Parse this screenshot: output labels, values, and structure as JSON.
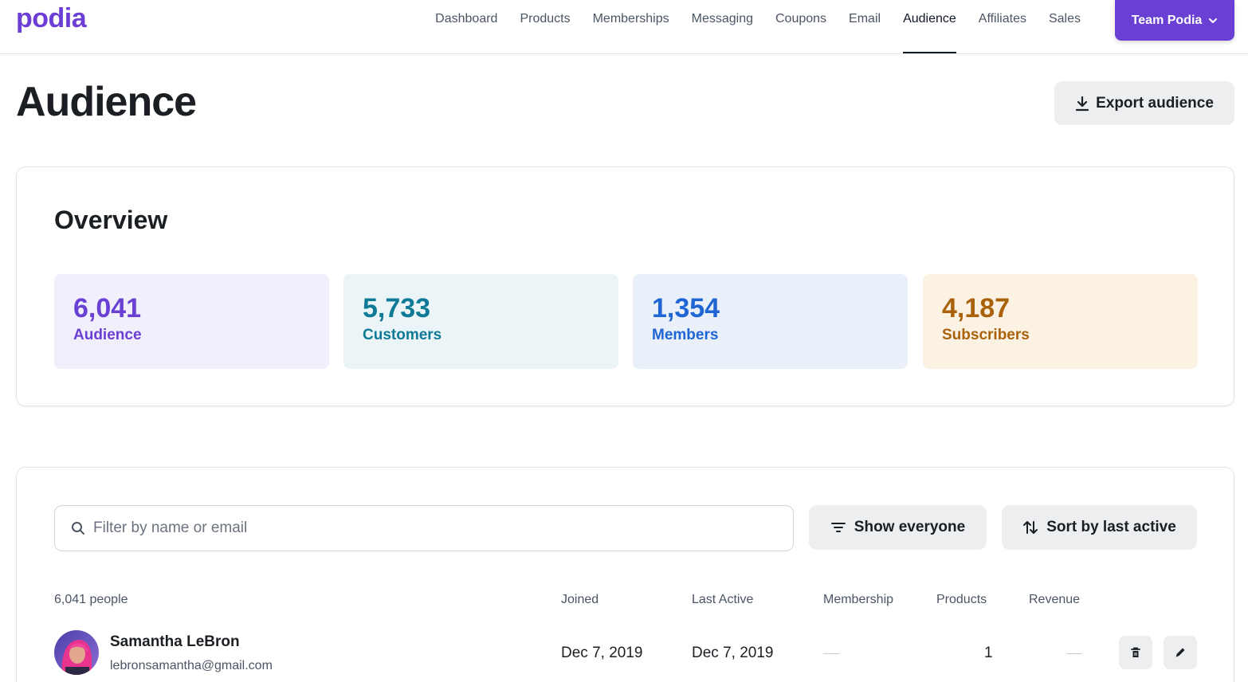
{
  "app": {
    "logo": "podia"
  },
  "nav": {
    "items": [
      {
        "label": "Dashboard"
      },
      {
        "label": "Products"
      },
      {
        "label": "Memberships"
      },
      {
        "label": "Messaging"
      },
      {
        "label": "Coupons"
      },
      {
        "label": "Email"
      },
      {
        "label": "Audience",
        "active": true
      },
      {
        "label": "Affiliates"
      },
      {
        "label": "Sales"
      }
    ],
    "team_button": "Team Podia"
  },
  "page": {
    "title": "Audience",
    "export_label": "Export audience"
  },
  "overview": {
    "title": "Overview",
    "stats": [
      {
        "value": "6,041",
        "label": "Audience",
        "bg": "#f1effb",
        "color": "#6a3fd3"
      },
      {
        "value": "5,733",
        "label": "Customers",
        "bg": "#ebf4f7",
        "color": "#0e7a96"
      },
      {
        "value": "1,354",
        "label": "Members",
        "bg": "#e9f0f9",
        "color": "#1f66d4"
      },
      {
        "value": "4,187",
        "label": "Subscribers",
        "bg": "#fbf2e3",
        "color": "#a9620b"
      }
    ]
  },
  "people": {
    "search_placeholder": "Filter by name or email",
    "show_label": "Show everyone",
    "sort_label": "Sort by last active",
    "count_label": "6,041 people",
    "columns": {
      "joined": "Joined",
      "last_active": "Last Active",
      "membership": "Membership",
      "products": "Products",
      "revenue": "Revenue"
    },
    "rows": [
      {
        "name": "Samantha LeBron",
        "email": "lebronsamantha@gmail.com",
        "joined": "Dec 7, 2019",
        "last_active": "Dec 7, 2019",
        "products": "1"
      }
    ]
  },
  "colors": {
    "accent": "#6a3fd3"
  }
}
